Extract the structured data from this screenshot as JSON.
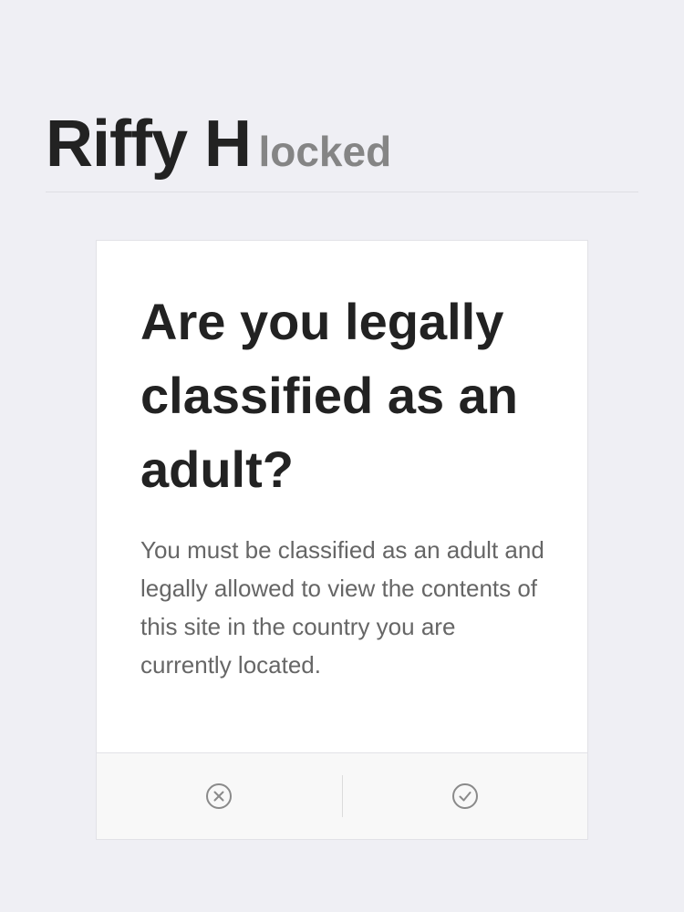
{
  "header": {
    "name": "Riffy H",
    "status": "locked"
  },
  "dialog": {
    "question": "Are you legally classified as an adult?",
    "description": "You must be classified as an adult and legally allowed to view the contents of this site in the country you are currently located.",
    "decline_icon": "circle-x-icon",
    "confirm_icon": "circle-check-icon"
  },
  "colors": {
    "background": "#efeff4",
    "icon": "#8a8a8a"
  }
}
